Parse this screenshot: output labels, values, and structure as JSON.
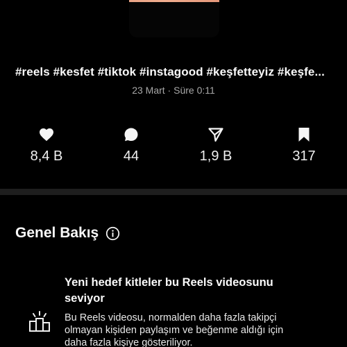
{
  "post": {
    "caption": "#reels #kesfet #tiktok #instagood #keşfetteyiz #keşfe...",
    "meta": "23 Mart · Süre 0:11"
  },
  "stats": {
    "likes": "8,4 B",
    "comments": "44",
    "shares": "1,9 B",
    "saves": "317"
  },
  "overview": {
    "title": "Genel Bakış"
  },
  "insight": {
    "title": "Yeni hedef kitleler bu Reels videosunu seviyor",
    "body": "Bu Reels videosu, normalden daha fazla takipçi olmayan kişiden paylaşım ve beğenme aldığı için daha fazla kişiye gösteriliyor."
  },
  "icons": {
    "likes": "heart-icon",
    "comments": "comment-icon",
    "shares": "share-icon",
    "saves": "bookmark-icon",
    "info": "info-icon",
    "insight": "audience-icon"
  }
}
